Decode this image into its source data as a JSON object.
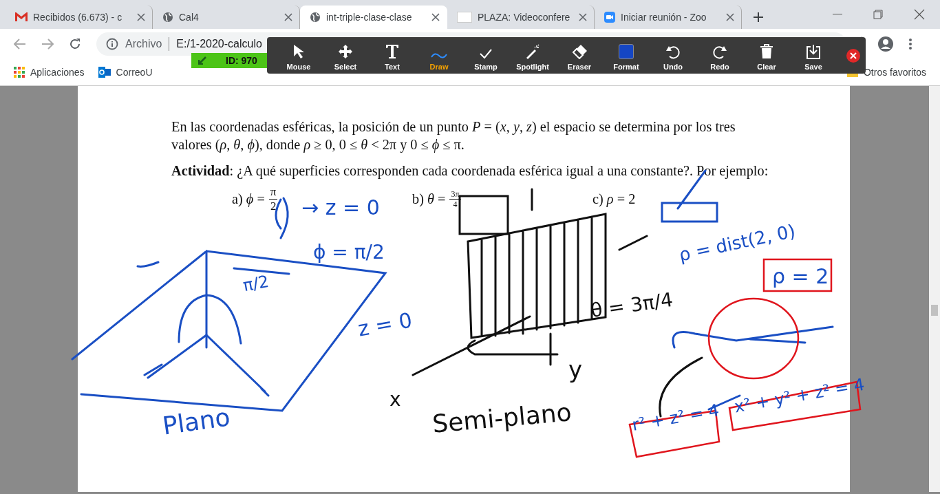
{
  "tabs": [
    {
      "title": "Recibidos (6.673) - c",
      "selected": false
    },
    {
      "title": "Cal4",
      "selected": false
    },
    {
      "title": "int-triple-clase-clase",
      "selected": true
    },
    {
      "title": "PLAZA: Videoconfere",
      "selected": false
    },
    {
      "title": "Iniciar reunión - Zoo",
      "selected": false
    }
  ],
  "address": {
    "scheme": "Archivo",
    "url": "E:/1-2020-calculo"
  },
  "bookmarks": [
    "Aplicaciones",
    "CorreoU"
  ],
  "other_bookmarks": "Otros favoritos",
  "meeting_id": "ID: 970",
  "annotate_tools": [
    {
      "label": "Mouse",
      "selected": false
    },
    {
      "label": "Select",
      "selected": false
    },
    {
      "label": "Text",
      "selected": false
    },
    {
      "label": "Draw",
      "selected": true
    },
    {
      "label": "Stamp",
      "selected": false
    },
    {
      "label": "Spotlight",
      "selected": false
    },
    {
      "label": "Eraser",
      "selected": false
    },
    {
      "label": "Format",
      "selected": false,
      "color": "#1546c4"
    },
    {
      "label": "Undo",
      "selected": false
    },
    {
      "label": "Redo",
      "selected": false
    },
    {
      "label": "Clear",
      "selected": false
    },
    {
      "label": "Save",
      "selected": false
    }
  ],
  "document": {
    "paragraphs": [
      "En las coordenadas esféricas, la posición de un punto *P* = (*x*, *y*, *z*) el espacio se determina por los tres valores (*ρ*, *θ*, *ϕ*), donde *ρ* ≥ 0, 0 ≤ *θ* < 2π y 0 ≤ *ϕ* ≤ π.",
      "**Actividad**: ¿A qué superficies corresponden cada coordenada esférica igual a una constante?. Por ejemplo:"
    ],
    "examples": [
      {
        "label": "a)",
        "lhs": "*ϕ* =",
        "numerator": "π",
        "denominator": "2"
      },
      {
        "label": "b)",
        "lhs": "*θ* =",
        "numerator": "3π",
        "denominator": "4"
      },
      {
        "label": "c)",
        "lhs": "*ρ* = 2"
      }
    ]
  },
  "ink_labels": [
    {
      "text": "→ z = 0",
      "color": "#1a4fc4"
    },
    {
      "text": "ϕ = π/2",
      "color": "#1a4fc4"
    },
    {
      "text": "π/2",
      "color": "#1a4fc4"
    },
    {
      "text": "z = 0",
      "color": "#1a4fc4"
    },
    {
      "text": "Plano",
      "color": "#1a4fc4"
    },
    {
      "text": "θ = 3π/4",
      "color": "#111111"
    },
    {
      "text": "y",
      "color": "#111111"
    },
    {
      "text": "x",
      "color": "#111111"
    },
    {
      "text": "Semi-plano",
      "color": "#111111"
    },
    {
      "text": "ρ = dist(2, 0)",
      "color": "#1a4fc4"
    },
    {
      "text": "ρ = 2",
      "color": "#1a4fc4"
    },
    {
      "text": "r² + z² = 4",
      "color": "#1a4fc4"
    },
    {
      "text": "x² + y² + z² = 4",
      "color": "#1a4fc4"
    }
  ]
}
